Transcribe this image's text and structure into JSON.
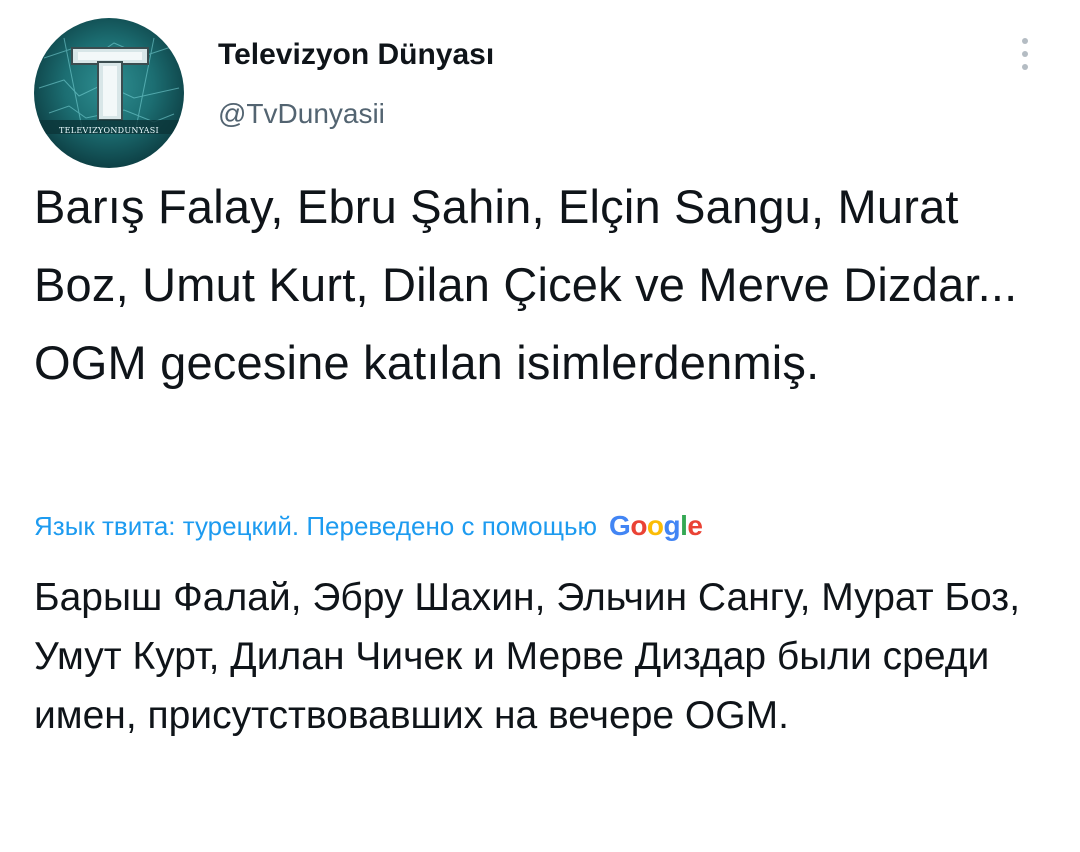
{
  "author": {
    "display_name": "Televizyon Dünyası",
    "handle": "@TvDunyasii",
    "avatar_caption": "TELEVIZYONDUNYASI"
  },
  "tweet": {
    "text": "Barış Falay, Ebru Şahin, Elçin Sangu, Murat Boz, Umut Kurt, Dilan Çicek ve Merve Dizdar... OGM gecesine katılan isimlerdenmiş."
  },
  "translation": {
    "label": "Язык твита: турецкий. Переведено с помощью",
    "provider": "Google",
    "provider_letters": [
      "G",
      "o",
      "o",
      "g",
      "l",
      "e"
    ],
    "text": "Барыш Фалай, Эбру Шахин, Эльчин Сангу, Мурат Боз, Умут Курт, Дилан Чичек и Мерве Диздар были среди имен, присутствовавших на вечере OGM."
  },
  "icons": {
    "more": "more-vertical-icon",
    "avatar_logo": "tv-logo-icon"
  },
  "colors": {
    "text_primary": "#0f1419",
    "text_secondary": "#536471",
    "link": "#1d9bf0",
    "avatar_bg": "#1c6e72"
  }
}
